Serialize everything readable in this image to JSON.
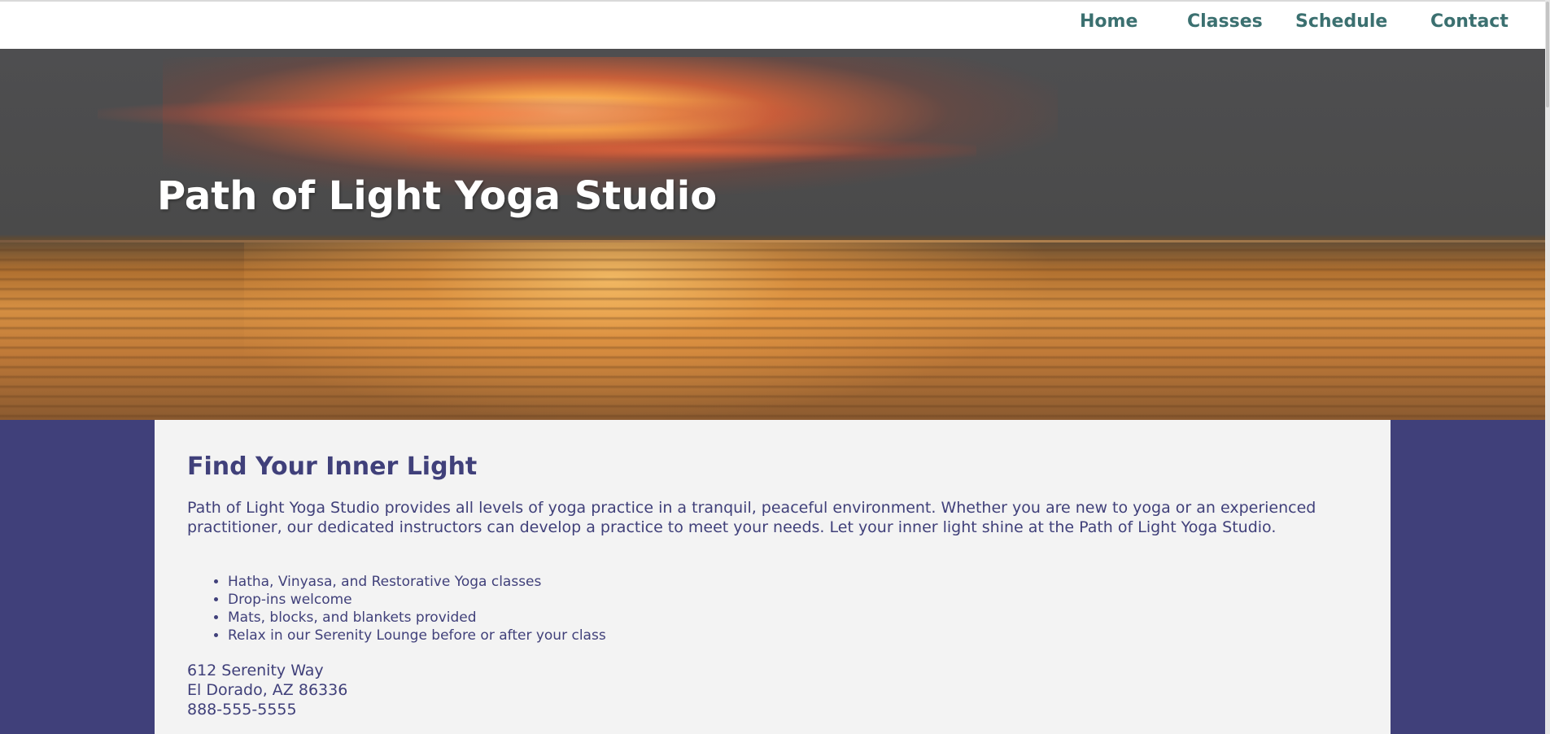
{
  "nav": {
    "items": [
      {
        "label": "Home"
      },
      {
        "label": "Classes"
      },
      {
        "label": "Schedule"
      },
      {
        "label": "Contact"
      }
    ]
  },
  "hero": {
    "title": "Path of Light Yoga Studio"
  },
  "main": {
    "heading": "Find Your Inner Light",
    "intro": "Path of Light Yoga Studio provides all levels of yoga practice in a tranquil, peaceful environment. Whether you are new to yoga or an experienced practitioner, our dedicated instructors can develop a practice to meet your needs. Let your inner light shine at the Path of Light Yoga Studio.",
    "features": [
      "Hatha, Vinyasa, and Restorative Yoga classes",
      "Drop-ins welcome",
      "Mats, blocks, and blankets provided",
      "Relax in our Serenity Lounge before or after your class"
    ],
    "address": {
      "street": "612 Serenity Way",
      "city": "El Dorado, AZ 86336",
      "phone": "888-555-5555"
    }
  },
  "colors": {
    "page_background": "#40407a",
    "nav_link": "#3b7070",
    "content_background": "#f3f3f3",
    "content_text": "#40407a",
    "hero_title": "#ffffff"
  }
}
